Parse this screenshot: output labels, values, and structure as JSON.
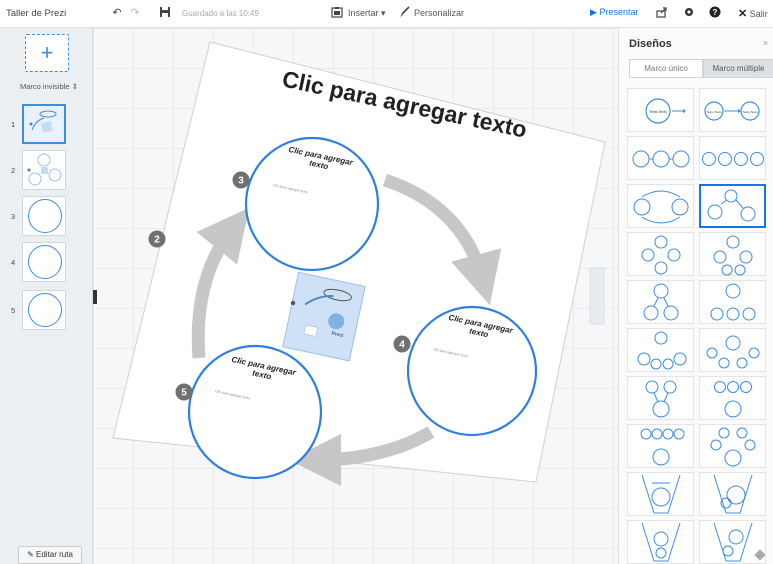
{
  "topbar": {
    "title": "Taller de Prezi",
    "saved_status": "Guardado a las 10:49",
    "insert_label": "Insertar",
    "customize_label": "Personalizar",
    "present_label": "Presentar",
    "exit_label": "Salir",
    "icons": [
      "undo-icon",
      "redo-icon",
      "save-icon",
      "insert-icon",
      "brush-icon",
      "play-icon",
      "share-icon",
      "gear-icon",
      "help-icon",
      "close-icon"
    ]
  },
  "sidebar": {
    "add_frame_symbol": "+",
    "frame_type": "Marco invisible",
    "thumbnails": [
      {
        "num": "1"
      },
      {
        "num": "2"
      },
      {
        "num": "3"
      },
      {
        "num": "4"
      },
      {
        "num": "5"
      }
    ],
    "edit_path_label": "Editar ruta"
  },
  "canvas": {
    "main_title": "Clic para agregar texto",
    "circles": [
      {
        "num": "3",
        "title": "Clic para agregar texto",
        "body": "Clic para agregar texto"
      },
      {
        "num": "4",
        "title": "Clic para agregar texto",
        "body": "Clic para agregar texto"
      },
      {
        "num": "5",
        "title": "Clic para agregar texto",
        "body": "Clic para agregar texto"
      }
    ],
    "step_2": "2",
    "center_label": "Prezi"
  },
  "designs": {
    "title": "Diseños",
    "close_symbol": "×",
    "tab_single": "Marco único",
    "tab_multiple": "Marco múltiple",
    "tile_text": "Texto Texto",
    "accent": "#3d8de0",
    "selected_color": "#1a73e8"
  }
}
